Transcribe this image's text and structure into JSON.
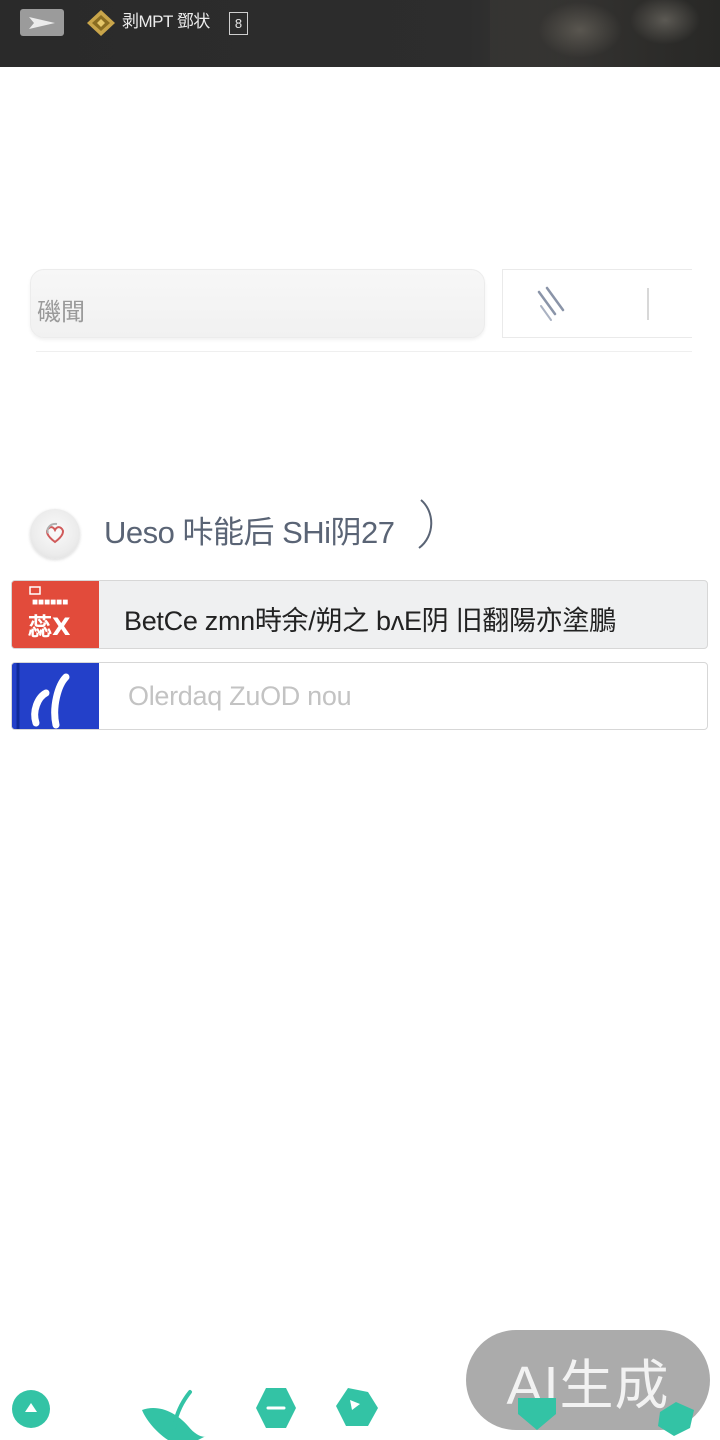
{
  "topbar": {
    "title": "剥MPT 鄧状",
    "box_glyph": "8"
  },
  "search": {
    "placeholder_text": "磯聞"
  },
  "section": {
    "title": "Ueso 咔能后 SHi阴27",
    "paren": ")"
  },
  "list": {
    "items": [
      {
        "label": "BetCe zmn時余/朔之 bʌE阴 旧翻陽亦塗鵬",
        "thumb_text": "蕊X",
        "thumb_color": "#e24b3b"
      },
      {
        "label": "Olerdaq ZuOD nou",
        "thumb_text": "",
        "thumb_color": "#2340c9"
      }
    ]
  },
  "watermark": {
    "text": "AI生成"
  },
  "colors": {
    "topbar": "#2b2b2b",
    "accent_teal": "#33c3a5",
    "section_title": "#5a6475"
  },
  "bottom_nav": {
    "icons": [
      "up-arrow-icon",
      "leaf-icon",
      "minus-icon",
      "tag-icon",
      "shield-icon",
      "diamond-icon"
    ]
  }
}
